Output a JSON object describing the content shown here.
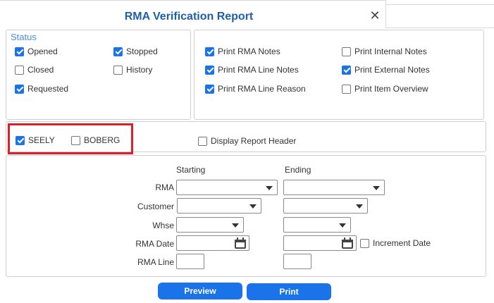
{
  "window": {
    "title": "RMA Verification Report",
    "close_glyph": "✕"
  },
  "status": {
    "legend": "Status",
    "items": [
      {
        "label": "Opened",
        "checked": true
      },
      {
        "label": "Stopped",
        "checked": true
      },
      {
        "label": "Closed",
        "checked": false
      },
      {
        "label": "History",
        "checked": false
      },
      {
        "label": "Requested",
        "checked": true
      }
    ]
  },
  "print_options": [
    {
      "label": "Print RMA Notes",
      "checked": true
    },
    {
      "label": "Print Internal Notes",
      "checked": false
    },
    {
      "label": "Print RMA Line Notes",
      "checked": true
    },
    {
      "label": "Print External Notes",
      "checked": true
    },
    {
      "label": "Print RMA Line Reason",
      "checked": true
    },
    {
      "label": "Print Item Overview",
      "checked": false
    }
  ],
  "companies": [
    {
      "label": "SEELY",
      "checked": true
    },
    {
      "label": "BOBERG",
      "checked": false
    }
  ],
  "display_header": {
    "label": "Display Report Header",
    "checked": false
  },
  "range": {
    "starting_label": "Starting",
    "ending_label": "Ending",
    "rows": [
      {
        "label": "RMA"
      },
      {
        "label": "Customer"
      },
      {
        "label": "Whse"
      },
      {
        "label": "RMA Date"
      },
      {
        "label": "RMA Line"
      }
    ],
    "increment_date": {
      "label": "Increment Date",
      "checked": false
    }
  },
  "buttons": {
    "preview": "Preview",
    "print": "Print"
  },
  "colors": {
    "accent": "#1a73e8",
    "title": "#1f5fa8",
    "highlight": "#d9202b",
    "legend": "#4a90d9"
  },
  "icons": {
    "close": "close-icon",
    "calendar": "calendar-icon",
    "dropdown": "chevron-down-icon",
    "check": "check-icon"
  }
}
